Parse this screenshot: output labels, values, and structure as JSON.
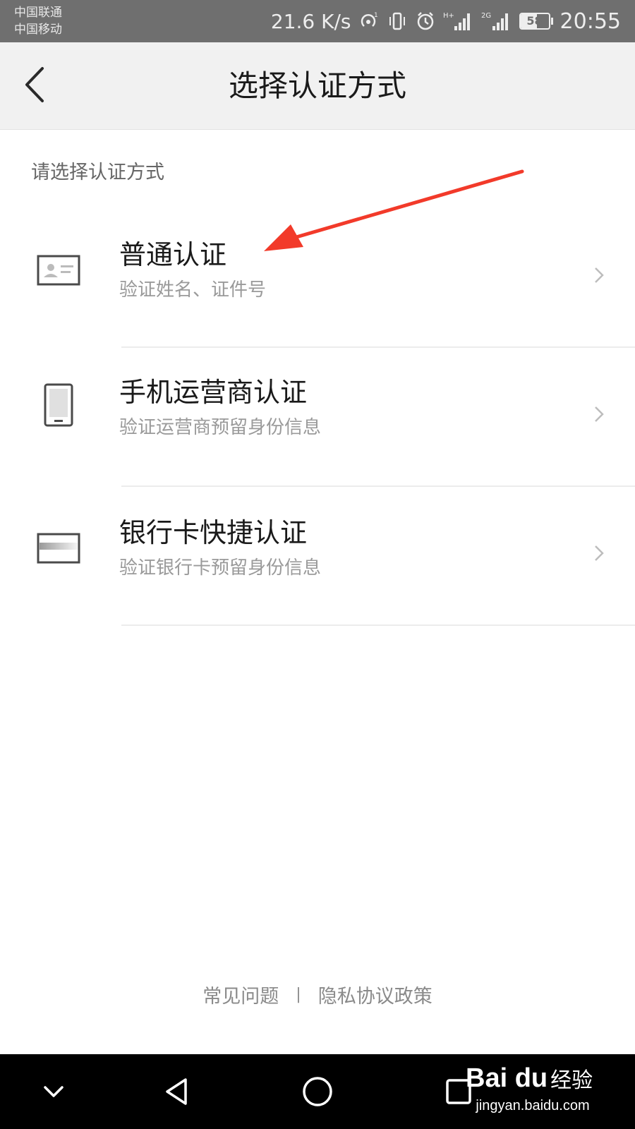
{
  "status_bar": {
    "carrier_1": "中国联通",
    "carrier_2": "中国移动",
    "net_speed": "21.6 K/s",
    "signal_1_label": "H+",
    "signal_2_label": "2G",
    "battery": "58",
    "battery_level": 0.58,
    "time": "20:55",
    "icons": [
      "hotspot-icon",
      "vibrate-icon",
      "alarm-icon",
      "signal-icon",
      "signal-icon",
      "battery-icon"
    ]
  },
  "header": {
    "title": "选择认证方式",
    "back_icon": "back-arrow-icon"
  },
  "main": {
    "hint": "请选择认证方式",
    "options": [
      {
        "title": "普通认证",
        "subtitle": "验证姓名、证件号",
        "icon": "id-card-icon"
      },
      {
        "title": "手机运营商认证",
        "subtitle": "验证运营商预留身份信息",
        "icon": "mobile-phone-icon"
      },
      {
        "title": "银行卡快捷认证",
        "subtitle": "验证银行卡预留身份信息",
        "icon": "bank-card-icon"
      }
    ]
  },
  "annotation": {
    "color": "#f23a2a"
  },
  "footer": {
    "faq": "常见问题",
    "separator": "|",
    "privacy": "隐私协议政策"
  },
  "nav_bar": {
    "buttons": [
      "collapse-icon",
      "back-triangle-icon",
      "home-circle-icon",
      "recents-square-icon"
    ]
  },
  "watermark": {
    "brand": "Bai du",
    "brand_cn": "经验",
    "url": "jingyan.baidu.com"
  }
}
